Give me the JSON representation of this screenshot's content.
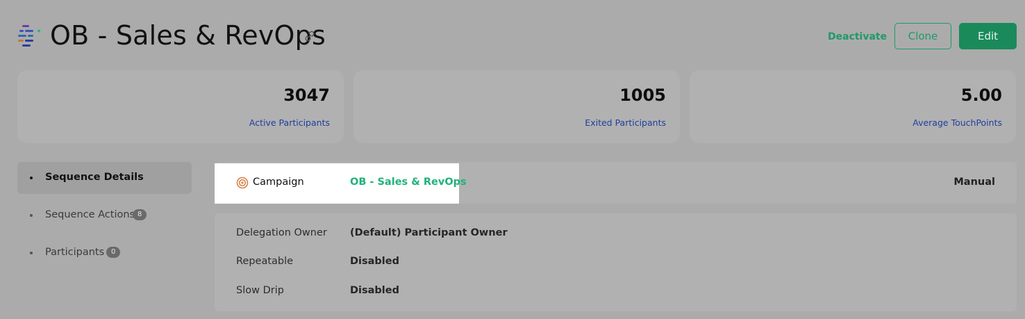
{
  "header": {
    "title": "OB - Sales & RevOps",
    "logo_icon": "sequence-logo-icon",
    "link_icon": "link-icon",
    "actions": {
      "deactivate": "Deactivate",
      "clone": "Clone",
      "edit": "Edit"
    }
  },
  "stats": [
    {
      "value": "3047",
      "label": "Active Participants"
    },
    {
      "value": "1005",
      "label": "Exited Participants"
    },
    {
      "value": "5.00",
      "label": "Average TouchPoints"
    }
  ],
  "sidebar": {
    "items": [
      {
        "label": "Sequence Details",
        "active": true
      },
      {
        "label": "Sequence Actions",
        "badge": "8"
      },
      {
        "label": "Participants",
        "badge": "0"
      }
    ]
  },
  "campaign": {
    "label": "Campaign",
    "value": "OB - Sales & RevOps",
    "mode": "Manual",
    "icon": "target-icon"
  },
  "details": [
    {
      "label": "Delegation Owner",
      "value": "(Default) Participant Owner"
    },
    {
      "label": "Repeatable",
      "value": "Disabled"
    },
    {
      "label": "Slow Drip",
      "value": "Disabled"
    }
  ],
  "colors": {
    "accent": "#1f9a68",
    "link": "#1f3ea1",
    "campaign_value": "#1fb27a"
  }
}
